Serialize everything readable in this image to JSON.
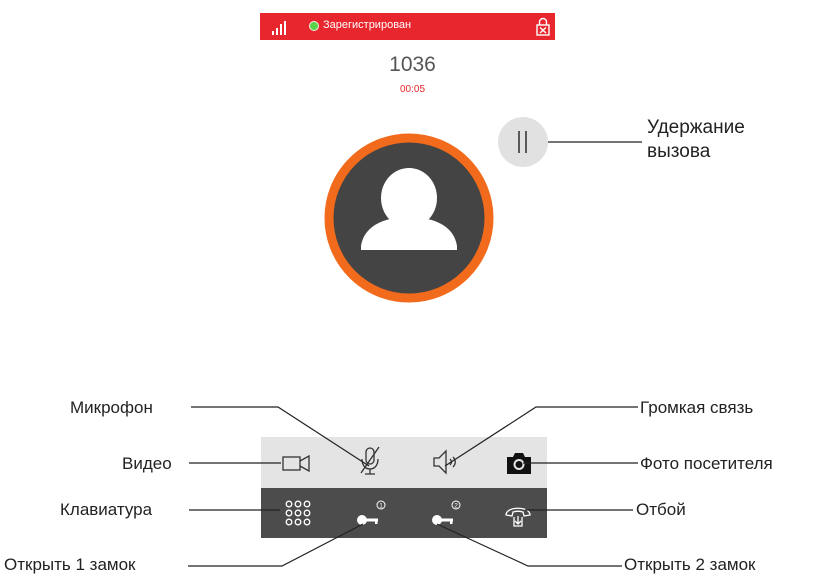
{
  "status_bar": {
    "registration_text": "Зарегистрирован",
    "background_color": "#e8262d",
    "indicator_color": "#5cd14a",
    "signal_icon": "signal-bars-icon",
    "lock_icon": "lock-cross-icon"
  },
  "call": {
    "number": "1036",
    "duration": "00:05"
  },
  "avatar": {
    "icon": "user-silhouette-icon",
    "ring_color": "#f26a1b",
    "fill_color": "#444444"
  },
  "hold_button": {
    "icon": "pause-icon"
  },
  "controls": {
    "top_row": [
      {
        "name": "video",
        "icon": "video-camera-icon"
      },
      {
        "name": "microphone",
        "icon": "microphone-muted-icon"
      },
      {
        "name": "speaker",
        "icon": "speaker-icon"
      },
      {
        "name": "photo",
        "icon": "camera-icon"
      }
    ],
    "bottom_row": [
      {
        "name": "keypad",
        "icon": "keypad-icon"
      },
      {
        "name": "open-lock-1",
        "icon": "key-1-icon"
      },
      {
        "name": "open-lock-2",
        "icon": "key-2-icon"
      },
      {
        "name": "hangup",
        "icon": "hangup-icon"
      }
    ]
  },
  "labels": {
    "hold_line1": "Удержание",
    "hold_line2": "вызова",
    "microphone": "Микрофон",
    "speaker": "Громкая связь",
    "video": "Видео",
    "photo": "Фото посетителя",
    "keypad": "Клавиатура",
    "hangup": "Отбой",
    "open_lock_1": "Открыть 1 замок",
    "open_lock_2": "Открыть 2 замок"
  }
}
